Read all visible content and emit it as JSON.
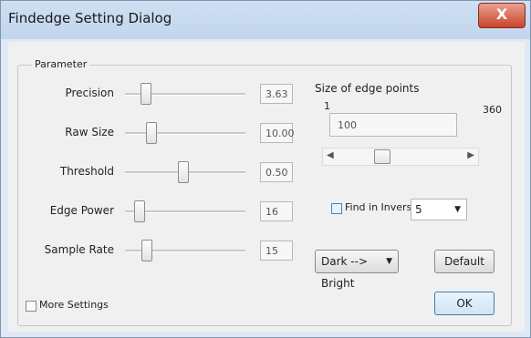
{
  "window": {
    "title": "Findedge Setting Dialog",
    "close_label": "X"
  },
  "parameter_group": {
    "legend": "Parameter"
  },
  "params": [
    {
      "label": "Precision",
      "value": "3.63",
      "slider_fraction": 0.12
    },
    {
      "label": "Raw Size",
      "value": "10.00",
      "slider_fraction": 0.2
    },
    {
      "label": "Threshold",
      "value": "0.50",
      "slider_fraction": 0.5
    },
    {
      "label": "Edge Power",
      "value": "16",
      "slider_fraction": 0.05
    },
    {
      "label": "Sample Rate",
      "value": "15",
      "slider_fraction": 0.15
    }
  ],
  "edge_points": {
    "title": "Size of edge points",
    "min_label": "1",
    "max_label": "360",
    "value": "100",
    "scroll_fraction": 0.3
  },
  "find_inverse": {
    "label": "Find in Inverse",
    "checked": false,
    "value": "5"
  },
  "direction": {
    "value": "Dark --> Bright"
  },
  "buttons": {
    "default_label": "Default",
    "ok_label": "OK"
  },
  "more_settings": {
    "label": "More Settings",
    "checked": false
  },
  "colors": {
    "title_bar": "#c2d5ec",
    "close_button": "#c8452c",
    "ok_border": "#3c7fb1"
  }
}
